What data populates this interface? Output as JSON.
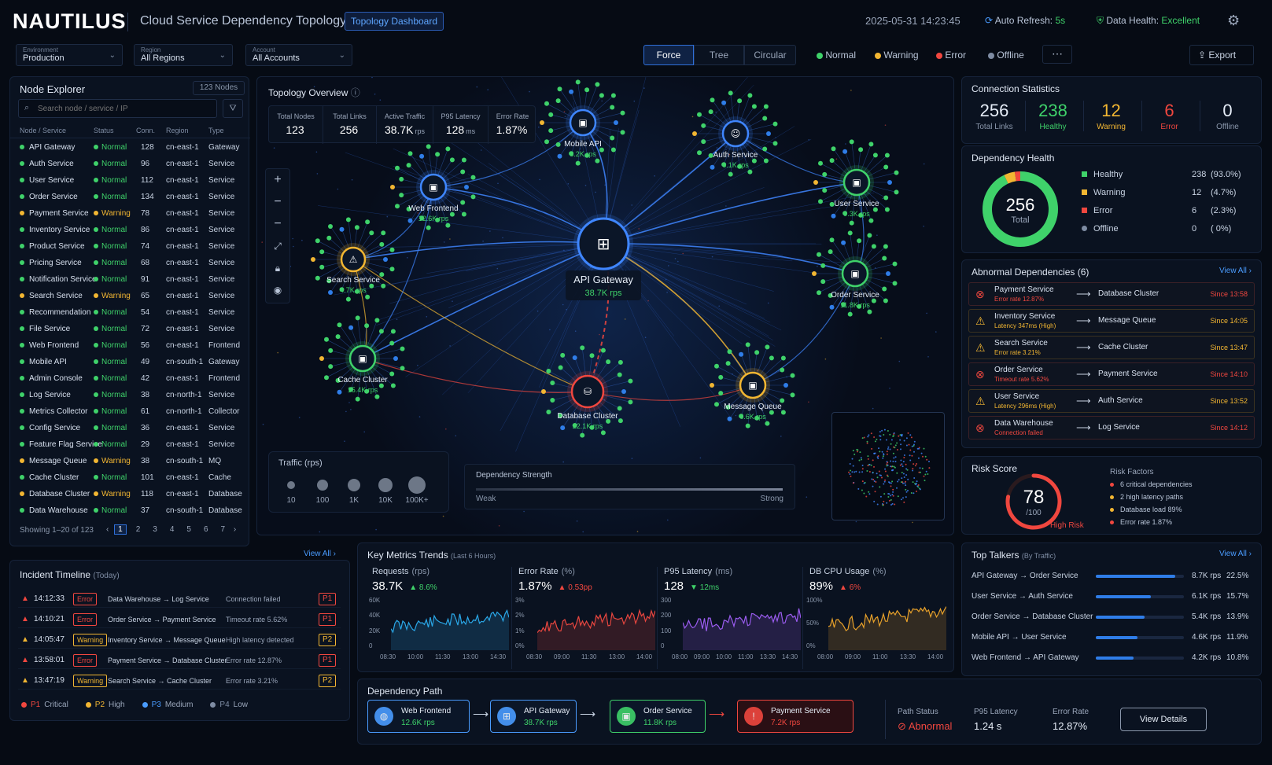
{
  "header": {
    "logo": "NAUTILUS",
    "title": "Cloud Service Dependency Topology",
    "dashboard_button": "Topology Dashboard",
    "datetime": "2025-05-31 14:23:45",
    "auto_refresh_label": "Auto Refresh:",
    "auto_refresh_value": "5s",
    "data_health_label": "Data Health:",
    "data_health_value": "Excellent"
  },
  "filters": {
    "environment": {
      "label": "Environment",
      "value": "Production"
    },
    "region": {
      "label": "Region",
      "value": "All Regions"
    },
    "account": {
      "label": "Account",
      "value": "All Accounts"
    }
  },
  "layout_modes": [
    "Force",
    "Tree",
    "Circular"
  ],
  "status_legend": [
    {
      "label": "Normal",
      "color": "#3fd26a"
    },
    {
      "label": "Warning",
      "color": "#f2b632"
    },
    {
      "label": "Error",
      "color": "#f0473f"
    },
    {
      "label": "Offline",
      "color": "#7e8ca3"
    }
  ],
  "more_button": "⋯",
  "export_button": "Export",
  "node_explorer": {
    "title": "Node Explorer",
    "count": "123 Nodes",
    "search_placeholder": "Search node / service / IP",
    "columns": [
      "Node / Service",
      "Status",
      "Conn.",
      "Region",
      "Type"
    ],
    "rows": [
      [
        "API Gateway",
        "Normal",
        "128",
        "cn-east-1",
        "Gateway"
      ],
      [
        "Auth Service",
        "Normal",
        "96",
        "cn-east-1",
        "Service"
      ],
      [
        "User Service",
        "Normal",
        "112",
        "cn-east-1",
        "Service"
      ],
      [
        "Order Service",
        "Normal",
        "134",
        "cn-east-1",
        "Service"
      ],
      [
        "Payment Service",
        "Warning",
        "78",
        "cn-east-1",
        "Service"
      ],
      [
        "Inventory Service",
        "Normal",
        "86",
        "cn-east-1",
        "Service"
      ],
      [
        "Product Service",
        "Normal",
        "74",
        "cn-east-1",
        "Service"
      ],
      [
        "Pricing Service",
        "Normal",
        "68",
        "cn-east-1",
        "Service"
      ],
      [
        "Notification Service",
        "Normal",
        "91",
        "cn-east-1",
        "Service"
      ],
      [
        "Search Service",
        "Warning",
        "65",
        "cn-east-1",
        "Service"
      ],
      [
        "Recommendation",
        "Normal",
        "54",
        "cn-east-1",
        "Service"
      ],
      [
        "File Service",
        "Normal",
        "72",
        "cn-east-1",
        "Service"
      ],
      [
        "Web Frontend",
        "Normal",
        "56",
        "cn-east-1",
        "Frontend"
      ],
      [
        "Mobile API",
        "Normal",
        "49",
        "cn-south-1",
        "Gateway"
      ],
      [
        "Admin Console",
        "Normal",
        "42",
        "cn-east-1",
        "Frontend"
      ],
      [
        "Log Service",
        "Normal",
        "38",
        "cn-north-1",
        "Service"
      ],
      [
        "Metrics Collector",
        "Normal",
        "61",
        "cn-north-1",
        "Collector"
      ],
      [
        "Config Service",
        "Normal",
        "36",
        "cn-east-1",
        "Service"
      ],
      [
        "Feature Flag Service",
        "Normal",
        "29",
        "cn-east-1",
        "Service"
      ],
      [
        "Message Queue",
        "Warning",
        "38",
        "cn-south-1",
        "MQ"
      ],
      [
        "Cache Cluster",
        "Normal",
        "101",
        "cn-east-1",
        "Cache"
      ],
      [
        "Database Cluster",
        "Warning",
        "118",
        "cn-east-1",
        "Database"
      ],
      [
        "Data Warehouse",
        "Normal",
        "37",
        "cn-south-1",
        "Database"
      ]
    ],
    "showing": "Showing 1–20 of 123",
    "pages": [
      "1",
      "2",
      "3",
      "4",
      "5",
      "6",
      "7"
    ],
    "view_all": "View All"
  },
  "incident": {
    "title": "Incident Timeline",
    "subtitle": "(Today)",
    "rows": [
      {
        "time": "14:12:33",
        "level": "Error",
        "path": "Data Warehouse → Log Service",
        "msg": "Connection failed",
        "p": "P1"
      },
      {
        "time": "14:10:21",
        "level": "Error",
        "path": "Order Service → Payment Service",
        "msg": "Timeout rate 5.62%",
        "p": "P1"
      },
      {
        "time": "14:05:47",
        "level": "Warning",
        "path": "Inventory Service → Message Queue",
        "msg": "High latency detected",
        "p": "P2"
      },
      {
        "time": "13:58:01",
        "level": "Error",
        "path": "Payment Service → Database Cluster",
        "msg": "Error rate 12.87%",
        "p": "P1"
      },
      {
        "time": "13:47:19",
        "level": "Warning",
        "path": "Search Service → Cache Cluster",
        "msg": "Error rate 3.21%",
        "p": "P2"
      }
    ],
    "legend": [
      {
        "p": "P1",
        "label": "Critical",
        "color": "#f0473f"
      },
      {
        "p": "P2",
        "label": "High",
        "color": "#f2b632"
      },
      {
        "p": "P3",
        "label": "Medium",
        "color": "#4a9cff"
      },
      {
        "p": "P4",
        "label": "Low",
        "color": "#7e8ca3"
      }
    ]
  },
  "topology": {
    "title": "Topology Overview",
    "stats": [
      {
        "label": "Total Nodes",
        "value": "123",
        "unit": ""
      },
      {
        "label": "Total Links",
        "value": "256",
        "unit": ""
      },
      {
        "label": "Active Traffic",
        "value": "38.7K",
        "unit": "rps"
      },
      {
        "label": "P95 Latency",
        "value": "128",
        "unit": "ms"
      },
      {
        "label": "Error Rate",
        "value": "1.87%",
        "unit": ""
      }
    ],
    "nodes": [
      {
        "name": "API Gateway",
        "rps": "38.7K rps",
        "status": "normal",
        "icon": "gateway-icon"
      },
      {
        "name": "Mobile API",
        "rps": "8.2K rps",
        "status": "normal",
        "icon": "mobile-icon"
      },
      {
        "name": "Auth Service",
        "rps": "6.1K rps",
        "status": "normal",
        "icon": "user-icon"
      },
      {
        "name": "Web Frontend",
        "rps": "12.6K rps",
        "status": "normal",
        "icon": "lock-icon"
      },
      {
        "name": "User Service",
        "rps": "9.3K rps",
        "status": "normal",
        "icon": "lock-icon"
      },
      {
        "name": "Search Service",
        "rps": "4.7K rps",
        "status": "warning",
        "icon": "warning-icon"
      },
      {
        "name": "Order Service",
        "rps": "11.8K rps",
        "status": "normal",
        "icon": "lock-icon"
      },
      {
        "name": "Cache Cluster",
        "rps": "15.4K rps",
        "status": "normal",
        "icon": "lock-icon"
      },
      {
        "name": "Database Cluster",
        "rps": "22.1K rps",
        "status": "error",
        "icon": "database-icon"
      },
      {
        "name": "Message Queue",
        "rps": "6.6K rps",
        "status": "warning",
        "icon": "queue-icon"
      }
    ],
    "traffic": {
      "title": "Traffic (rps)",
      "levels": [
        "10",
        "100",
        "1K",
        "10K",
        "100K+"
      ]
    },
    "strength": {
      "title": "Dependency Strength",
      "weak": "Weak",
      "strong": "Strong"
    }
  },
  "conn_stats": {
    "title": "Connection Statistics",
    "items": [
      {
        "value": "256",
        "label": "Total Links",
        "color": "#e6edf7"
      },
      {
        "value": "238",
        "label": "Healthy",
        "color": "#3fd26a"
      },
      {
        "value": "12",
        "label": "Warning",
        "color": "#f2b632"
      },
      {
        "value": "6",
        "label": "Error",
        "color": "#f0473f"
      },
      {
        "value": "0",
        "label": "Offline",
        "color": "#e6edf7"
      }
    ]
  },
  "dep_health": {
    "title": "Dependency Health",
    "total": "256",
    "total_label": "Total",
    "items": [
      {
        "label": "Healthy",
        "count": "238",
        "pct": "(93.0%)",
        "color": "#3fd26a",
        "value": 238
      },
      {
        "label": "Warning",
        "count": "12",
        "pct": "(4.7%)",
        "color": "#f2b632",
        "value": 12
      },
      {
        "label": "Error",
        "count": "6",
        "pct": "(2.3%)",
        "color": "#f0473f",
        "value": 6
      },
      {
        "label": "Offline",
        "count": "0",
        "pct": "( 0%)",
        "color": "#7e8ca3",
        "value": 0
      }
    ]
  },
  "abnormal": {
    "title": "Abnormal Dependencies",
    "count": "(6)",
    "view_all": "View All",
    "rows": [
      {
        "from": "Payment Service",
        "detail": "Error rate 12.87%",
        "to": "Database Cluster",
        "since": "Since 13:58",
        "sev": "error"
      },
      {
        "from": "Inventory Service",
        "detail": "Latency 347ms (High)",
        "to": "Message Queue",
        "since": "Since 14:05",
        "sev": "warning"
      },
      {
        "from": "Search Service",
        "detail": "Error rate 3.21%",
        "to": "Cache Cluster",
        "since": "Since 13:47",
        "sev": "warning"
      },
      {
        "from": "Order Service",
        "detail": "Timeout rate 5.62%",
        "to": "Payment Service",
        "since": "Since 14:10",
        "sev": "error"
      },
      {
        "from": "User Service",
        "detail": "Latency 296ms (High)",
        "to": "Auth Service",
        "since": "Since 13:52",
        "sev": "warning"
      },
      {
        "from": "Data Warehouse",
        "detail": "Connection failed",
        "to": "Log Service",
        "since": "Since 14:12",
        "sev": "error"
      }
    ]
  },
  "risk": {
    "title": "Risk Score",
    "score": "78",
    "max": "/100",
    "level": "High Risk",
    "score_value": 78,
    "factors_title": "Risk Factors",
    "factors": [
      {
        "text": "6 critical dependencies",
        "color": "#f0473f"
      },
      {
        "text": "2 high latency paths",
        "color": "#f2b632"
      },
      {
        "text": "Database load 89%",
        "color": "#f2b632"
      },
      {
        "text": "Error rate 1.87%",
        "color": "#f0473f"
      }
    ]
  },
  "talkers": {
    "title": "Top Talkers",
    "subtitle": "(By Traffic)",
    "view_all": "View All",
    "rows": [
      {
        "path": "API Gateway → Order Service",
        "rps": "8.7K rps",
        "pct": "22.5%",
        "value": 22.5
      },
      {
        "path": "User Service → Auth Service",
        "rps": "6.1K rps",
        "pct": "15.7%",
        "value": 15.7
      },
      {
        "path": "Order Service → Database Cluster",
        "rps": "5.4K rps",
        "pct": "13.9%",
        "value": 13.9
      },
      {
        "path": "Mobile API → User Service",
        "rps": "4.6K rps",
        "pct": "11.9%",
        "value": 11.9
      },
      {
        "path": "Web Frontend → API Gateway",
        "rps": "4.2K rps",
        "pct": "10.8%",
        "value": 10.8
      }
    ]
  },
  "metrics": {
    "title": "Key Metrics Trends",
    "subtitle": "(Last 6 Hours)",
    "cards": [
      {
        "title": "Requests",
        "unit": "(rps)",
        "value": "38.7K",
        "delta": "▲ 8.6%",
        "delta_color": "#3fd26a",
        "color": "#2aa8e8",
        "yticks": [
          "60K",
          "40K",
          "20K",
          "0"
        ],
        "xticks": [
          "08:30",
          "10:00",
          "11:30",
          "13:00",
          "14:30"
        ]
      },
      {
        "title": "Error Rate",
        "unit": "(%)",
        "value": "1.87%",
        "delta": "▲ 0.53pp",
        "delta_color": "#f0473f",
        "color": "#e8463f",
        "yticks": [
          "3%",
          "2%",
          "1%",
          "0%"
        ],
        "xticks": [
          "08:30",
          "09:00",
          "11:30",
          "13:00",
          "14:00"
        ]
      },
      {
        "title": "P95 Latency",
        "unit": "(ms)",
        "value": "128",
        "delta": "▼ 12ms",
        "delta_color": "#3fd26a",
        "color": "#9b5cf0",
        "yticks": [
          "300",
          "200",
          "100",
          "0"
        ],
        "xticks": [
          "08:00",
          "09:00",
          "10:00",
          "11:00",
          "13:30",
          "14:30"
        ]
      },
      {
        "title": "DB CPU Usage",
        "unit": "(%)",
        "value": "89%",
        "delta": "▲ 6%",
        "delta_color": "#f0473f",
        "color": "#e8a12a",
        "yticks": [
          "100%",
          "50%",
          "0%"
        ],
        "xticks": [
          "08:00",
          "09:00",
          "11:00",
          "13:30",
          "14:00"
        ]
      }
    ]
  },
  "dep_path": {
    "title": "Dependency Path",
    "nodes": [
      {
        "name": "Web Frontend",
        "rps": "12.6K rps",
        "color": "#4a9cff",
        "icon": "globe-icon"
      },
      {
        "name": "API Gateway",
        "rps": "38.7K rps",
        "color": "#4a9cff",
        "icon": "gateway-icon"
      },
      {
        "name": "Order Service",
        "rps": "11.8K rps",
        "color": "#3fd26a",
        "icon": "lock-icon"
      },
      {
        "name": "Payment Service",
        "rps": "7.2K rps",
        "color": "#f0473f",
        "icon": "error-icon"
      }
    ],
    "status_label": "Path Status",
    "status_value": "Abnormal",
    "latency_label": "P95 Latency",
    "latency_value": "1.24 s",
    "error_label": "Error Rate",
    "error_value": "12.87%",
    "details_button": "View Details"
  }
}
